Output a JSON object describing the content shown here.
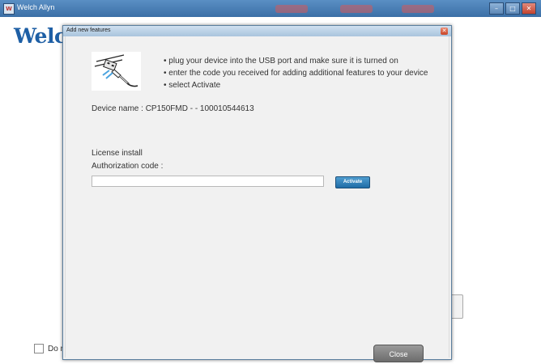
{
  "main_window": {
    "title": "Welch Allyn",
    "app_icon": "welch-allyn-app-icon",
    "brand_text": "Welc",
    "checkbox_label": "Do n",
    "controls": [
      "minimize",
      "maximize",
      "close"
    ]
  },
  "dialog": {
    "title": "Add new features",
    "close_icon": "close-icon",
    "illustration": "usb-plug-icon",
    "instructions": [
      "• plug your device into the USB port and make sure it is turned on",
      "• enter the code you received for adding additional features to your device",
      "• select Activate"
    ],
    "device_name_line": "Device name :  CP150FMD -  - 100010544613",
    "license_heading": "License install",
    "auth_label": "Authorization code :",
    "auth_value": "",
    "activate_label": "Activate",
    "close_label": "Close"
  },
  "colors": {
    "accent": "#1f6ca6",
    "brand": "#1e5fa5",
    "titlebar": "#3b6fa6"
  }
}
